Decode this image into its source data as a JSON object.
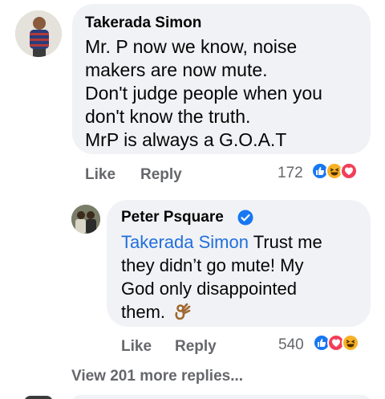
{
  "comment": {
    "author": "Takerada Simon",
    "lines": [
      "Mr. P now we know, noise",
      "makers are now mute.",
      "Don't judge people when you",
      "don't know the truth.",
      "MrP is always a G.O.A.T"
    ],
    "actions": {
      "like": "Like",
      "reply": "Reply"
    },
    "reaction_count": "172",
    "reactions": [
      "like-icon",
      "haha-icon",
      "love-icon"
    ]
  },
  "reply": {
    "author": "Peter Psquare",
    "verified": true,
    "mention": "Takerada Simon",
    "lines": [
      "Trust me",
      "they didn’t go mute! My",
      "God only disappointed",
      "them."
    ],
    "emoji": "ok-hand-icon",
    "actions": {
      "like": "Like",
      "reply": "Reply"
    },
    "reaction_count": "540",
    "reactions": [
      "like-icon",
      "love-icon",
      "haha-icon"
    ]
  },
  "view_more": "View 201 more replies...",
  "colors": {
    "bubble": "#f0f2f5",
    "action": "#65676b",
    "mention": "#216fdb",
    "like": "#1877f2",
    "love": "#f33e58",
    "haha": "#f7b125"
  }
}
